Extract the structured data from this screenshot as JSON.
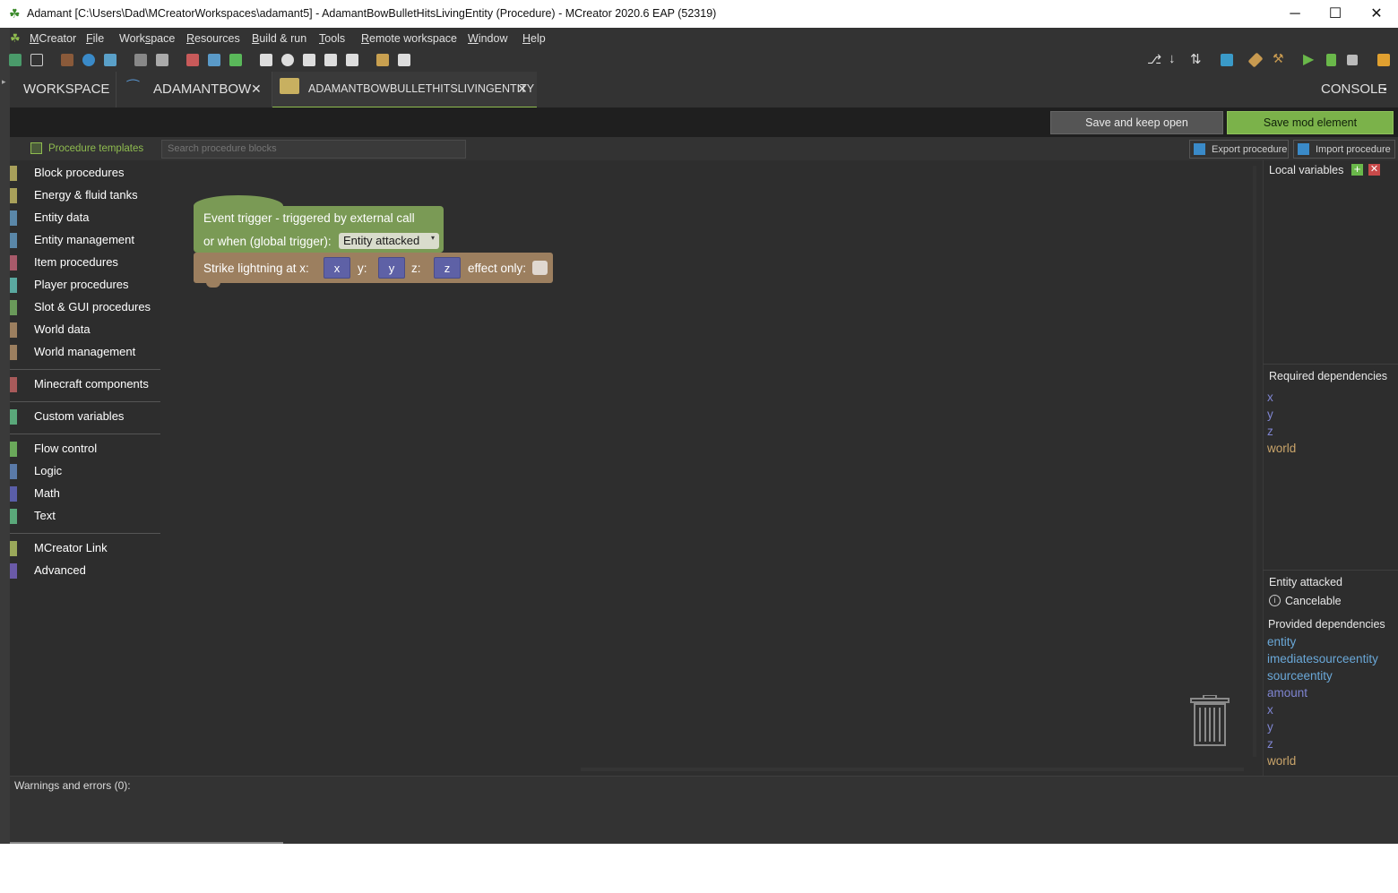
{
  "window": {
    "title": "Adamant [C:\\Users\\Dad\\MCreatorWorkspaces\\adamant5] - AdamantBowBulletHitsLivingEntity (Procedure) - MCreator 2020.6 EAP (52319)",
    "minimize": "─",
    "maximize": "☐",
    "close": "✕"
  },
  "menubar": {
    "items": [
      {
        "pre": "",
        "u": "M",
        "post": "Creator"
      },
      {
        "pre": "",
        "u": "F",
        "post": "ile"
      },
      {
        "pre": "Work",
        "u": "s",
        "post": "pace"
      },
      {
        "pre": "",
        "u": "R",
        "post": "esources"
      },
      {
        "pre": "",
        "u": "B",
        "post": "uild & run"
      },
      {
        "pre": "",
        "u": "T",
        "post": "ools"
      },
      {
        "pre": "",
        "u": "R",
        "post": "emote workspace"
      },
      {
        "pre": "",
        "u": "W",
        "post": "indow"
      },
      {
        "pre": "",
        "u": "H",
        "post": "elp"
      }
    ]
  },
  "tabs": {
    "workspace": "WORKSPACE",
    "adamantbow": "ADAMANTBOW",
    "active": "ADAMANTBOWBULLETHITSLIVINGENTITY",
    "close_glyph": "✕",
    "console": "CONSOLE"
  },
  "actions": {
    "save_keep_open": "Save and keep open",
    "save_mod_element": "Save mod element"
  },
  "subbar": {
    "procedure_templates": "Procedure templates",
    "search_placeholder": "Search procedure blocks",
    "export": "Export procedure",
    "import": "Import procedure"
  },
  "categories": {
    "group1": [
      {
        "label": "Block procedures",
        "color": "#a8a05a"
      },
      {
        "label": "Energy & fluid tanks",
        "color": "#a8a05a"
      },
      {
        "label": "Entity data",
        "color": "#5a87a8"
      },
      {
        "label": "Entity management",
        "color": "#5a87a8"
      },
      {
        "label": "Item procedures",
        "color": "#a85a6a"
      },
      {
        "label": "Player procedures",
        "color": "#5aa8a0"
      },
      {
        "label": "Slot & GUI procedures",
        "color": "#6a9a5a"
      },
      {
        "label": "World data",
        "color": "#9c7f5f"
      },
      {
        "label": "World management",
        "color": "#9c7f5f"
      }
    ],
    "group2": [
      {
        "label": "Minecraft components",
        "color": "#a85a5a"
      }
    ],
    "group3": [
      {
        "label": "Custom variables",
        "color": "#5aa87a"
      }
    ],
    "group4": [
      {
        "label": "Flow control",
        "color": "#6aa85a"
      },
      {
        "label": "Logic",
        "color": "#5a7aa8"
      },
      {
        "label": "Math",
        "color": "#5a5ea8"
      },
      {
        "label": "Text",
        "color": "#5aa87a"
      }
    ],
    "group5": [
      {
        "label": "MCreator Link",
        "color": "#9aa85a"
      },
      {
        "label": "Advanced",
        "color": "#6a5aa8"
      }
    ]
  },
  "blocks": {
    "event_line1": "Event trigger - triggered by external call",
    "event_line2": "or when (global trigger):",
    "event_dropdown": "Entity attacked",
    "strike_label": "Strike lightning at x:",
    "y_label": "y:",
    "z_label": "z:",
    "x_val": "x",
    "y_val": "y",
    "z_val": "z",
    "effect_only": "effect only:"
  },
  "right_panel": {
    "local_variables": "Local variables",
    "required_dependencies": "Required dependencies",
    "required": [
      "x",
      "y",
      "z",
      "world"
    ],
    "trigger_name": "Entity attacked",
    "cancelable": "Cancelable",
    "provided_dependencies": "Provided dependencies",
    "provided": [
      "entity",
      "imediatesourceentity",
      "sourceentity",
      "amount",
      "x",
      "y",
      "z",
      "world"
    ]
  },
  "warnings": {
    "label": "Warnings and errors (0):"
  }
}
